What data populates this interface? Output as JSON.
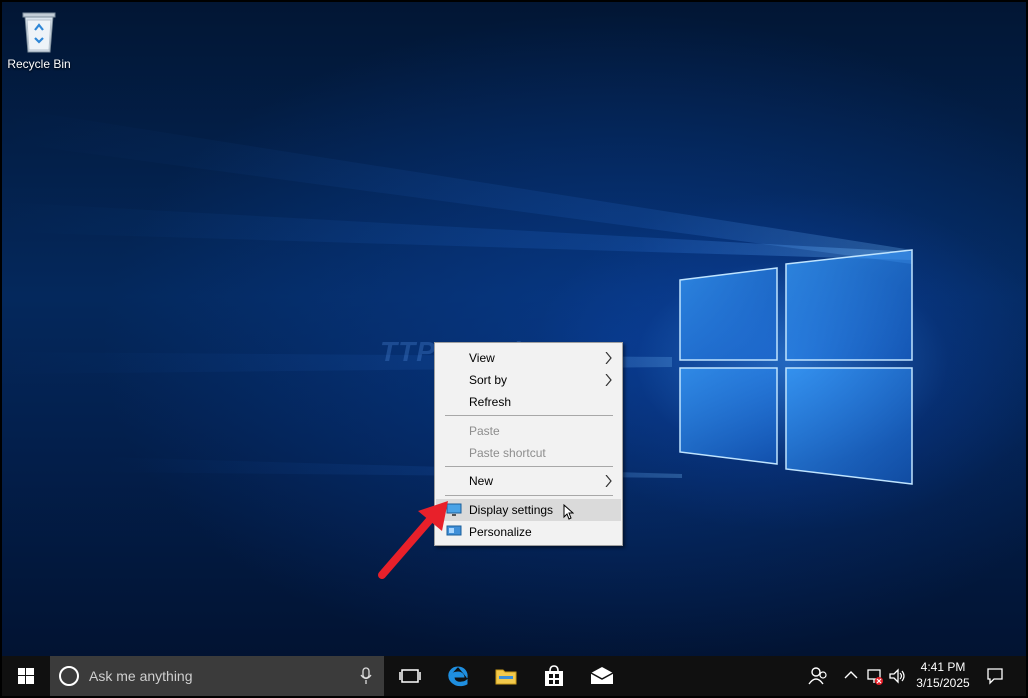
{
  "desktop": {
    "recycle_bin_label": "Recycle Bin",
    "watermark": "TTPros Hire"
  },
  "context_menu": {
    "items": [
      {
        "label": "View",
        "submenu": true,
        "enabled": true
      },
      {
        "label": "Sort by",
        "submenu": true,
        "enabled": true
      },
      {
        "label": "Refresh",
        "submenu": false,
        "enabled": true
      },
      {
        "label": "Paste",
        "submenu": false,
        "enabled": false
      },
      {
        "label": "Paste shortcut",
        "submenu": false,
        "enabled": false
      },
      {
        "label": "New",
        "submenu": true,
        "enabled": true
      },
      {
        "label": "Display settings",
        "submenu": false,
        "enabled": true,
        "highlighted": true,
        "icon": "display-icon"
      },
      {
        "label": "Personalize",
        "submenu": false,
        "enabled": true,
        "icon": "personalize-icon"
      }
    ]
  },
  "taskbar": {
    "search_placeholder": "Ask me anything",
    "pinned": [
      "task-view-icon",
      "edge-icon",
      "file-explorer-icon",
      "store-icon",
      "mail-icon"
    ],
    "tray_icons": [
      "people-icon",
      "chevron-up-icon",
      "network-icon",
      "volume-icon"
    ],
    "time": "4:41 PM",
    "date": "3/15/2025"
  },
  "colors": {
    "accent_arrow": "#e8202a",
    "taskbar": "#101010",
    "search_box": "#3b3b3b",
    "menu_highlight": "#dadada"
  }
}
